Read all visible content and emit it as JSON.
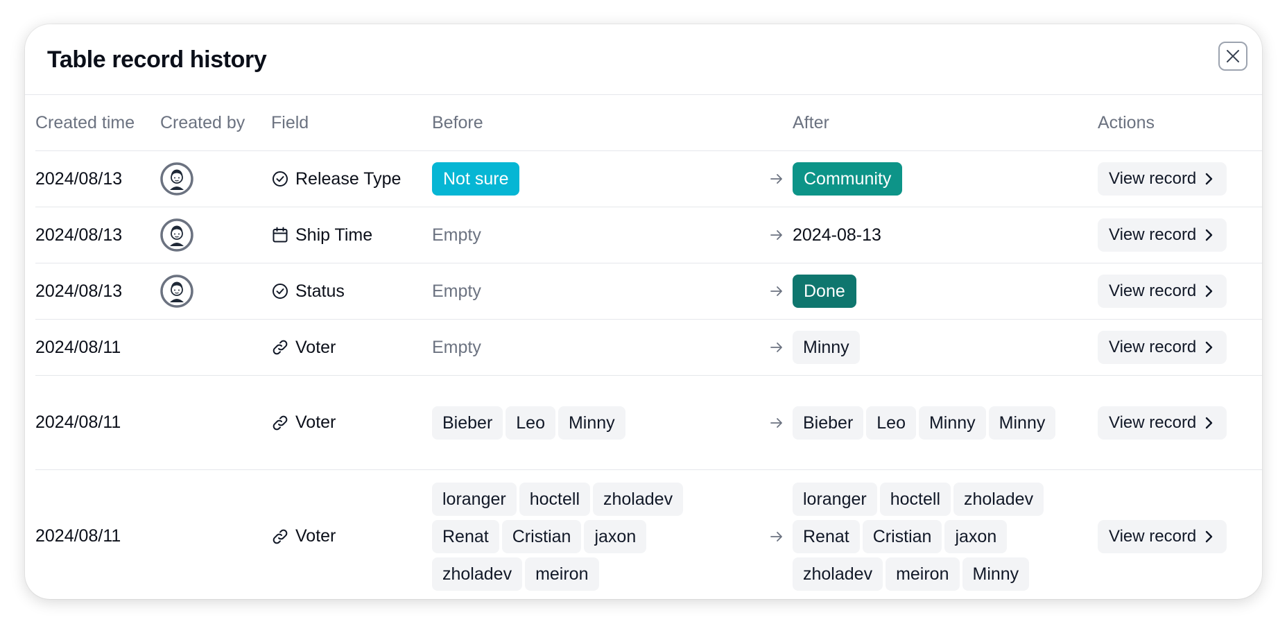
{
  "dialog": {
    "title": "Table record history"
  },
  "columns": [
    "Created time",
    "Created by",
    "Field",
    "Before",
    "After",
    "Actions"
  ],
  "colors": {
    "cyan": "#06b6d4",
    "teal": "#0d9488",
    "teal_dark": "#0f766e"
  },
  "view_record_label": "View record",
  "rows": [
    {
      "created_time": "2024/08/13",
      "has_avatar": true,
      "field_icon": "single-select-icon",
      "field": "Release Type",
      "before": {
        "kind": "badge",
        "text": "Not sure",
        "color": "#06b6d4"
      },
      "after": {
        "kind": "badge",
        "text": "Community",
        "color": "#0d9488"
      }
    },
    {
      "created_time": "2024/08/13",
      "has_avatar": true,
      "field_icon": "calendar-icon",
      "field": "Ship Time",
      "before": {
        "kind": "empty",
        "text": "Empty"
      },
      "after": {
        "kind": "text",
        "text": "2024-08-13"
      }
    },
    {
      "created_time": "2024/08/13",
      "has_avatar": true,
      "field_icon": "single-select-icon",
      "field": "Status",
      "before": {
        "kind": "empty",
        "text": "Empty"
      },
      "after": {
        "kind": "badge",
        "text": "Done",
        "color": "#0f766e"
      }
    },
    {
      "created_time": "2024/08/11",
      "has_avatar": false,
      "field_icon": "link-icon",
      "field": "Voter",
      "before": {
        "kind": "empty",
        "text": "Empty"
      },
      "after": {
        "kind": "chips",
        "items": [
          "Minny"
        ]
      }
    },
    {
      "created_time": "2024/08/11",
      "has_avatar": false,
      "field_icon": "link-icon",
      "field": "Voter",
      "before": {
        "kind": "chips",
        "items": [
          "Bieber",
          "Leo",
          "Minny"
        ]
      },
      "after": {
        "kind": "chips",
        "items": [
          "Bieber",
          "Leo",
          "Minny",
          "Minny"
        ]
      }
    },
    {
      "created_time": "2024/08/11",
      "has_avatar": false,
      "field_icon": "link-icon",
      "field": "Voter",
      "before": {
        "kind": "chips",
        "items": [
          "loranger",
          "hoctell",
          "zholadev",
          "Renat",
          "Cristian",
          "jaxon",
          "zholadev",
          "meiron"
        ]
      },
      "after": {
        "kind": "chips",
        "items": [
          "loranger",
          "hoctell",
          "zholadev",
          "Renat",
          "Cristian",
          "jaxon",
          "zholadev",
          "meiron",
          "Minny"
        ]
      }
    }
  ]
}
